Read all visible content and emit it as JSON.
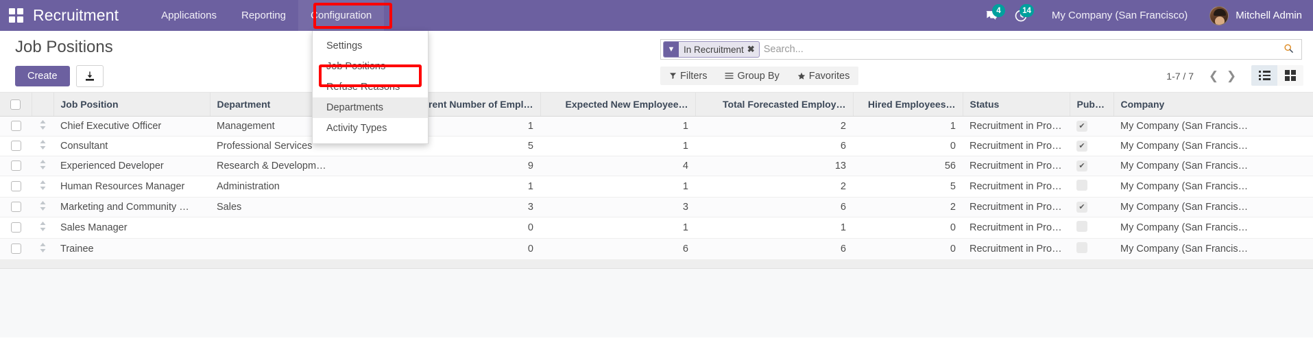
{
  "navbar": {
    "apps_icon": "apps-grid-icon",
    "brand": "Recruitment",
    "menu": [
      {
        "label": "Applications"
      },
      {
        "label": "Reporting"
      },
      {
        "label": "Configuration"
      }
    ],
    "messages_badge": "4",
    "activities_badge": "14",
    "company": "My Company (San Francisco)",
    "user": "Mitchell Admin"
  },
  "dropdown": {
    "items": [
      {
        "label": "Settings",
        "highlighted": false
      },
      {
        "label": "Job Positions",
        "highlighted": false
      },
      {
        "label": "Refuse Reasons",
        "highlighted": false
      },
      {
        "label": "Departments",
        "highlighted": true
      },
      {
        "label": "Activity Types",
        "highlighted": false
      }
    ]
  },
  "control": {
    "page_title": "Job Positions",
    "create_label": "Create",
    "import_icon": "import-download-icon",
    "search": {
      "facet_label": "In Recruitment",
      "facet_icon": "filter-funnel-icon",
      "facet_remove_icon": "close-x-icon",
      "placeholder": "Search...",
      "value": "",
      "magnifier_icon": "search-icon"
    },
    "filters_label": "Filters",
    "groupby_label": "Group By",
    "favorites_label": "Favorites",
    "pager_text": "1-7 / 7",
    "prev_icon": "chevron-left-icon",
    "next_icon": "chevron-right-icon",
    "view_list_icon": "list-view-icon",
    "view_kanban_icon": "kanban-view-icon",
    "active_view": "list"
  },
  "table": {
    "columns": [
      {
        "label": "Job Position",
        "align": "left"
      },
      {
        "label": "Department",
        "align": "left"
      },
      {
        "label": "Current Number of Empl…",
        "align": "right"
      },
      {
        "label": "Expected New Employee…",
        "align": "right"
      },
      {
        "label": "Total Forecasted Employ…",
        "align": "right"
      },
      {
        "label": "Hired Employees…",
        "align": "right"
      },
      {
        "label": "Status",
        "align": "left"
      },
      {
        "label": "Publish…",
        "align": "left"
      },
      {
        "label": "Company",
        "align": "left"
      }
    ],
    "rows": [
      {
        "job_position": "Chief Executive Officer",
        "department": "Management",
        "current_employees": "1",
        "expected_new": "1",
        "total_forecasted": "2",
        "hired": "1",
        "status": "Recruitment in Progr…",
        "published": true,
        "company": "My Company (San Francis…"
      },
      {
        "job_position": "Consultant",
        "department": "Professional Services",
        "current_employees": "5",
        "expected_new": "1",
        "total_forecasted": "6",
        "hired": "0",
        "status": "Recruitment in Progr…",
        "published": true,
        "company": "My Company (San Francis…"
      },
      {
        "job_position": "Experienced Developer",
        "department": "Research & Developm…",
        "current_employees": "9",
        "expected_new": "4",
        "total_forecasted": "13",
        "hired": "56",
        "status": "Recruitment in Progr…",
        "published": true,
        "company": "My Company (San Francis…"
      },
      {
        "job_position": "Human Resources Manager",
        "department": "Administration",
        "current_employees": "1",
        "expected_new": "1",
        "total_forecasted": "2",
        "hired": "5",
        "status": "Recruitment in Progr…",
        "published": false,
        "company": "My Company (San Francis…"
      },
      {
        "job_position": "Marketing and Community …",
        "department": "Sales",
        "current_employees": "3",
        "expected_new": "3",
        "total_forecasted": "6",
        "hired": "2",
        "status": "Recruitment in Progr…",
        "published": true,
        "company": "My Company (San Francis…"
      },
      {
        "job_position": "Sales Manager",
        "department": "",
        "current_employees": "0",
        "expected_new": "1",
        "total_forecasted": "1",
        "hired": "0",
        "status": "Recruitment in Progr…",
        "published": false,
        "company": "My Company (San Francis…"
      },
      {
        "job_position": "Trainee",
        "department": "",
        "current_employees": "0",
        "expected_new": "6",
        "total_forecasted": "6",
        "hired": "0",
        "status": "Recruitment in Progr…",
        "published": false,
        "company": "My Company (San Francis…"
      }
    ]
  },
  "colors": {
    "brand_purple": "#6c60a0",
    "teal_badge": "#00a09d",
    "annotation_red": "#ff0000",
    "header_gray": "#eeeeee"
  }
}
